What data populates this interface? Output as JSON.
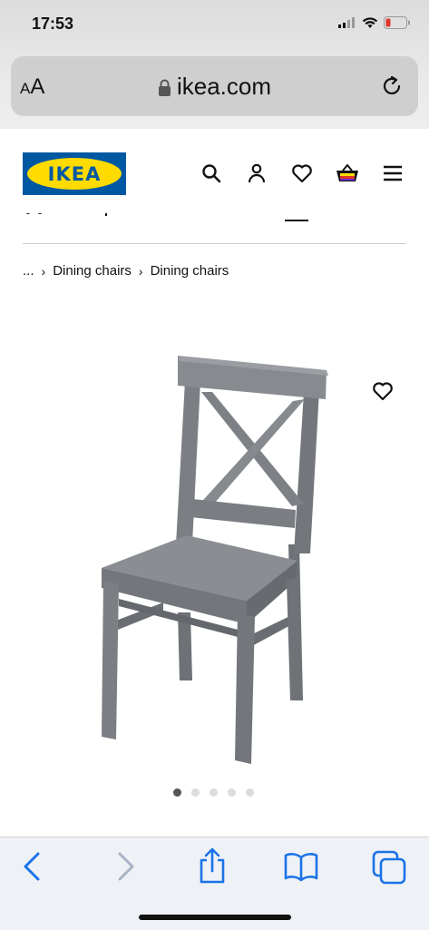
{
  "status_bar": {
    "time": "17:53"
  },
  "browser": {
    "text_size_small": "A",
    "text_size_large": "A",
    "url": "ikea.com"
  },
  "header": {
    "logo_text": "IKEA",
    "icons": [
      "search-icon",
      "account-icon",
      "heart-icon",
      "basket-icon",
      "menu-icon"
    ]
  },
  "breadcrumb": {
    "ellipsis": "...",
    "items": [
      "Dining chairs",
      "Dining chairs"
    ]
  },
  "product": {
    "image_count": 5,
    "active_image": 1
  },
  "colors": {
    "ikea_blue": "#0058a3",
    "ikea_yellow": "#ffdb00",
    "safari_blue": "#1a73e8",
    "chair_gray": "#7d8187"
  }
}
